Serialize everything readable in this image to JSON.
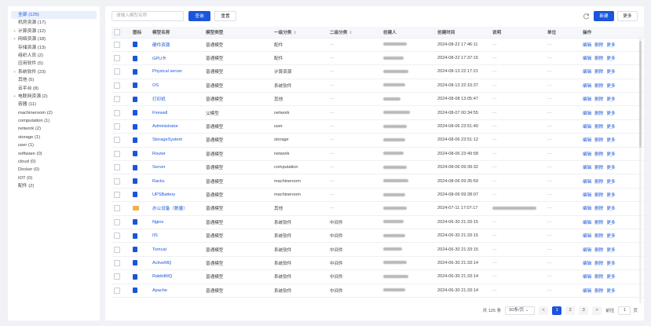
{
  "sidebar": {
    "items": [
      {
        "label": "全部 (125)",
        "caret": "",
        "active": true
      },
      {
        "label": "机房资源 (17)",
        "caret": "",
        "active": false
      },
      {
        "label": "计算资源 (12)",
        "caret": "+",
        "active": false
      },
      {
        "label": "网络资源 (18)",
        "caret": "+",
        "active": false
      },
      {
        "label": "存储资源 (13)",
        "caret": "",
        "active": false
      },
      {
        "label": "组织人员 (2)",
        "caret": "",
        "active": false
      },
      {
        "label": "应用软件 (5)",
        "caret": "",
        "active": false
      },
      {
        "label": "系统软件 (23)",
        "caret": "+",
        "active": false
      },
      {
        "label": "其他 (5)",
        "caret": "",
        "active": false
      },
      {
        "label": "云平台 (8)",
        "caret": "",
        "active": false
      },
      {
        "label": "电联网资源 (2)",
        "caret": "+",
        "active": false
      },
      {
        "label": "容器 (11)",
        "caret": "",
        "active": false
      },
      {
        "label": "machineroom (2)",
        "caret": "",
        "active": false
      },
      {
        "label": "computation (1)",
        "caret": "",
        "active": false
      },
      {
        "label": "network (2)",
        "caret": "",
        "active": false
      },
      {
        "label": "storage (1)",
        "caret": "",
        "active": false
      },
      {
        "label": "user (1)",
        "caret": "",
        "active": false
      },
      {
        "label": "software (0)",
        "caret": "",
        "active": false
      },
      {
        "label": "cloud (0)",
        "caret": "",
        "active": false
      },
      {
        "label": "Docker (0)",
        "caret": "",
        "active": false
      },
      {
        "label": "IOT (0)",
        "caret": "",
        "active": false
      },
      {
        "label": "配件 (2)",
        "caret": "",
        "active": false
      }
    ]
  },
  "toolbar": {
    "search_placeholder": "请输入模型名称",
    "query_label": "查询",
    "reset_label": "重置",
    "new_label": "新建",
    "more_label": "更多"
  },
  "table": {
    "headers": {
      "icon": "图标",
      "name": "模型名称",
      "type": "模型类型",
      "cat1": "一级分类",
      "cat2": "二级分类",
      "creator": "创建人",
      "created": "创建时间",
      "desc": "说明",
      "unit": "单位",
      "ops": "操作"
    },
    "actions": {
      "edit": "编辑",
      "delete": "删除",
      "more": "更多"
    },
    "rows": [
      {
        "icon": "model",
        "name": "硬件资源",
        "type": "普通模型",
        "cat1": "配件",
        "cat2": "—",
        "created": "2024-08-22 17:46:11",
        "desc": "—",
        "unit": "—"
      },
      {
        "icon": "model",
        "name": "GPU卡",
        "type": "普通模型",
        "cat1": "配件",
        "cat2": "—",
        "created": "2024-08-22 17:37:15",
        "desc": "—",
        "unit": "—"
      },
      {
        "icon": "model",
        "name": "Physical server",
        "type": "普通模型",
        "cat1": "计算资源",
        "cat2": "—",
        "created": "2024-08-13 22:17:21",
        "desc": "—",
        "unit": "—"
      },
      {
        "icon": "model",
        "name": "OS",
        "type": "普通模型",
        "cat1": "系统软件",
        "cat2": "—",
        "created": "2024-08-13 22:10:37",
        "desc": "—",
        "unit": "—"
      },
      {
        "icon": "model",
        "name": "打印机",
        "type": "普通模型",
        "cat1": "其他",
        "cat2": "—",
        "created": "2024-08-08 13:05:47",
        "desc": "—",
        "unit": "—"
      },
      {
        "icon": "model",
        "name": "Firewall",
        "type": "父模型",
        "cat1": "network",
        "cat2": "—",
        "created": "2024-08-07 00:34:55",
        "desc": "—",
        "unit": "—"
      },
      {
        "icon": "model",
        "name": "Administrator",
        "type": "普通模型",
        "cat1": "user",
        "cat2": "—",
        "created": "2024-08-06 23:51:40",
        "desc": "—",
        "unit": "—"
      },
      {
        "icon": "model",
        "name": "StorageSystem",
        "type": "普通模型",
        "cat1": "storage",
        "cat2": "—",
        "created": "2024-08-06 23:51:12",
        "desc": "—",
        "unit": "—"
      },
      {
        "icon": "model",
        "name": "Router",
        "type": "普通模型",
        "cat1": "network",
        "cat2": "—",
        "created": "2024-08-06 23:49:58",
        "desc": "—",
        "unit": "—"
      },
      {
        "icon": "model",
        "name": "Server",
        "type": "普通模型",
        "cat1": "computation",
        "cat2": "—",
        "created": "2024-08-06 09:39:32",
        "desc": "—",
        "unit": "—"
      },
      {
        "icon": "model",
        "name": "Racks",
        "type": "普通模型",
        "cat1": "machineroom",
        "cat2": "—",
        "created": "2024-08-06 09:35:59",
        "desc": "—",
        "unit": "—"
      },
      {
        "icon": "model",
        "name": "UPSBattery",
        "type": "普通模型",
        "cat1": "machineroom",
        "cat2": "—",
        "created": "2024-08-06 09:28:07",
        "desc": "—",
        "unit": "—"
      },
      {
        "icon": "folder",
        "name": "办公设备（数量）",
        "type": "普通模型",
        "cat1": "其他",
        "cat2": "—",
        "created": "2024-07-11 17:07:17",
        "desc": "",
        "unit": "—"
      },
      {
        "icon": "model",
        "name": "Nginx",
        "type": "普通模型",
        "cat1": "系统软件",
        "cat2": "中间件",
        "created": "2024-06-30 21:33:15",
        "desc": "—",
        "unit": "—"
      },
      {
        "icon": "model",
        "name": "IIS",
        "type": "普通模型",
        "cat1": "系统软件",
        "cat2": "中间件",
        "created": "2024-06-30 21:33:15",
        "desc": "—",
        "unit": "—"
      },
      {
        "icon": "model",
        "name": "Tomcat",
        "type": "普通模型",
        "cat1": "系统软件",
        "cat2": "中间件",
        "created": "2024-06-30 21:33:15",
        "desc": "—",
        "unit": "—"
      },
      {
        "icon": "model",
        "name": "ActiveMQ",
        "type": "普通模型",
        "cat1": "系统软件",
        "cat2": "中间件",
        "created": "2024-06-30 21:33:14",
        "desc": "—",
        "unit": "—"
      },
      {
        "icon": "model",
        "name": "RabbitMQ",
        "type": "普通模型",
        "cat1": "系统软件",
        "cat2": "中间件",
        "created": "2024-06-30 21:33:14",
        "desc": "—",
        "unit": "—"
      },
      {
        "icon": "model",
        "name": "Apache",
        "type": "普通模型",
        "cat1": "系统软件",
        "cat2": "中间件",
        "created": "2024-06-30 21:33:14",
        "desc": "—",
        "unit": "—"
      }
    ]
  },
  "pager": {
    "total": "共 125 条",
    "page_size": "50条/页",
    "pages": [
      "1",
      "2",
      "3"
    ],
    "current": "1",
    "goto_label": "前往",
    "goto_value": "1",
    "page_suffix": "页",
    "prev": "<",
    "next": ">"
  },
  "colors": {
    "primary": "#1a56db",
    "folder": "#f2b343"
  }
}
